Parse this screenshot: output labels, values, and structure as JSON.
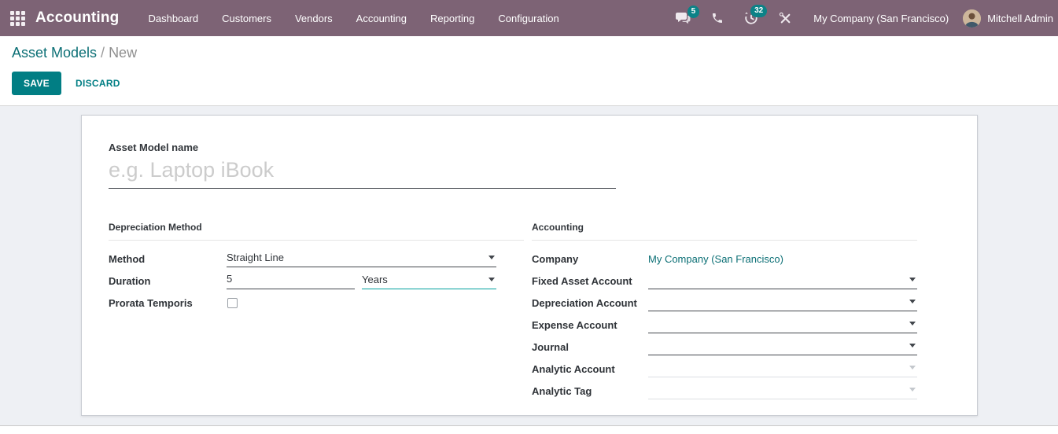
{
  "topbar": {
    "brand": "Accounting",
    "menu_items": [
      "Dashboard",
      "Customers",
      "Vendors",
      "Accounting",
      "Reporting",
      "Configuration"
    ],
    "messages_badge": "5",
    "activities_badge": "32",
    "company_switcher": "My Company (San Francisco)",
    "user_name": "Mitchell Admin"
  },
  "breadcrumb": {
    "parent": "Asset Models",
    "separator": "/",
    "current": "New"
  },
  "actions": {
    "save": "SAVE",
    "discard": "DISCARD"
  },
  "form": {
    "name_label": "Asset Model name",
    "name_placeholder": "e.g. Laptop iBook",
    "name_value": "",
    "left_section": {
      "title": "Depreciation Method",
      "fields": {
        "method": {
          "label": "Method",
          "value": "Straight Line"
        },
        "duration": {
          "label": "Duration",
          "value": "5",
          "unit": "Years"
        },
        "prorata": {
          "label": "Prorata Temporis",
          "checked": false
        }
      }
    },
    "right_section": {
      "title": "Accounting",
      "fields": {
        "company": {
          "label": "Company",
          "value": "My Company (San Francisco)"
        },
        "fixed_asset_account": {
          "label": "Fixed Asset Account",
          "value": ""
        },
        "depreciation_account": {
          "label": "Depreciation Account",
          "value": ""
        },
        "expense_account": {
          "label": "Expense Account",
          "value": ""
        },
        "journal": {
          "label": "Journal",
          "value": ""
        },
        "analytic_account": {
          "label": "Analytic Account",
          "value": "",
          "disabled": true
        },
        "analytic_tag": {
          "label": "Analytic Tag",
          "value": "",
          "disabled": true
        }
      }
    }
  },
  "colors": {
    "topbar_bg": "#7d6375",
    "accent_teal": "#017e84",
    "badge_teal": "#0c8287",
    "content_bg": "#eef0f4"
  }
}
